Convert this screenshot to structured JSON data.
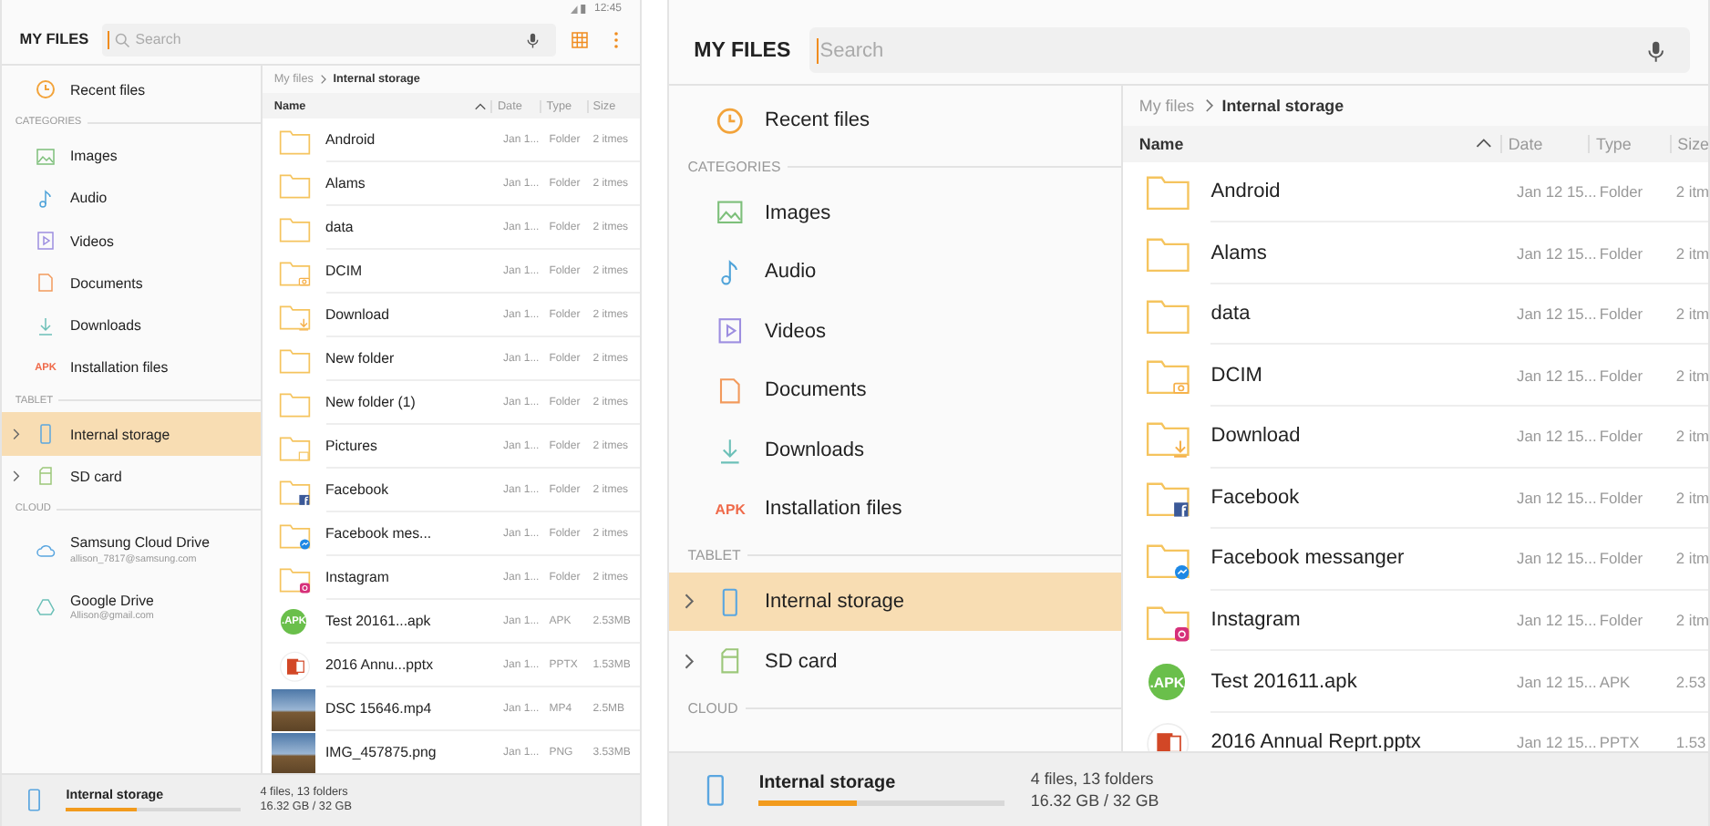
{
  "screens": [
    {
      "status_bar": {
        "time": "12:45"
      },
      "header": {
        "title": "MY FILES",
        "search": {
          "placeholder": "Search"
        }
      },
      "sidebar": [
        {
          "kind": "item",
          "label": "Recent files",
          "selected": false
        },
        {
          "kind": "header",
          "label": "CATEGORIES"
        },
        {
          "kind": "item",
          "label": "Images",
          "selected": false
        },
        {
          "kind": "item",
          "label": "Audio",
          "selected": false
        },
        {
          "kind": "item",
          "label": "Videos",
          "selected": false
        },
        {
          "kind": "item",
          "label": "Documents",
          "selected": false
        },
        {
          "kind": "item",
          "label": "Downloads",
          "selected": false
        },
        {
          "kind": "item",
          "icon_text": "APK",
          "label": "Installation files",
          "selected": false
        },
        {
          "kind": "header",
          "label": "TABLET"
        },
        {
          "kind": "storage",
          "label": "Internal storage",
          "selected": true
        },
        {
          "kind": "storage",
          "label": "SD card",
          "selected": false
        },
        {
          "kind": "header",
          "label": "CLOUD"
        },
        {
          "kind": "account",
          "label": "Samsung Cloud Drive",
          "sublabel": "allison_7817@samsung.com",
          "selected": false
        },
        {
          "kind": "account",
          "label": "Google Drive",
          "sublabel": "Allison@gmail.com",
          "selected": false
        }
      ],
      "breadcrumb": [
        "My files",
        "Internal storage"
      ],
      "columns": [
        "Name",
        "Date",
        "Type",
        "Size"
      ],
      "rows": [
        {
          "kind": "folder",
          "name": "Android",
          "date": "Jan 1...",
          "type": "Folder",
          "size": "2 itmes"
        },
        {
          "kind": "folder",
          "name": "Alams",
          "date": "Jan 1...",
          "type": "Folder",
          "size": "2 itmes"
        },
        {
          "kind": "folder",
          "name": "data",
          "date": "Jan 1...",
          "type": "Folder",
          "size": "2 itmes"
        },
        {
          "kind": "camera",
          "name": "DCIM",
          "date": "Jan 1...",
          "type": "Folder",
          "size": "2 itmes"
        },
        {
          "kind": "download",
          "name": "Download",
          "date": "Jan 1...",
          "type": "Folder",
          "size": "2 itmes"
        },
        {
          "kind": "folder",
          "name": "New folder",
          "date": "Jan 1...",
          "type": "Folder",
          "size": "2 itmes"
        },
        {
          "kind": "folder",
          "name": "New folder (1)",
          "date": "Jan 1...",
          "type": "Folder",
          "size": "2 itmes"
        },
        {
          "kind": "pictures",
          "name": "Pictures",
          "date": "Jan 1...",
          "type": "Folder",
          "size": "2 itmes"
        },
        {
          "kind": "facebook",
          "name": "Facebook",
          "date": "Jan 1...",
          "type": "Folder",
          "size": "2 itmes"
        },
        {
          "kind": "messenger",
          "name": "Facebook mes...",
          "date": "Jan 1...",
          "type": "Folder",
          "size": "2 itmes"
        },
        {
          "kind": "instagram",
          "name": "Instagram",
          "date": "Jan 1...",
          "type": "Folder",
          "size": "2 itmes"
        },
        {
          "kind": "apk",
          "icon_text": ".APK",
          "name": "Test 20161...apk",
          "date": "Jan 1...",
          "type": "APK",
          "size": "2.53MB"
        },
        {
          "kind": "pptx",
          "name": "2016 Annu...pptx",
          "date": "Jan 1...",
          "type": "PPTX",
          "size": "1.53MB"
        },
        {
          "kind": "photo",
          "name": "DSC 15646.mp4",
          "date": "Jan 1...",
          "type": "MP4",
          "size": "2.5MB"
        },
        {
          "kind": "photo",
          "name": "IMG_457875.png",
          "date": "Jan 1...",
          "type": "PNG",
          "size": "3.53MB"
        }
      ],
      "footer": {
        "label": "Internal storage",
        "level": 0.4,
        "counts": "4 files, 13 folders",
        "usage": "16.32 GB / 32 GB"
      }
    },
    {
      "header": {
        "title": "MY FILES",
        "search": {
          "placeholder": "Search"
        }
      },
      "sidebar": [
        {
          "kind": "item",
          "label": "Recent files",
          "selected": false
        },
        {
          "kind": "header",
          "label": "CATEGORIES"
        },
        {
          "kind": "item",
          "label": "Images",
          "selected": false
        },
        {
          "kind": "item",
          "label": "Audio",
          "selected": false
        },
        {
          "kind": "item",
          "label": "Videos",
          "selected": false
        },
        {
          "kind": "item",
          "label": "Documents",
          "selected": false
        },
        {
          "kind": "item",
          "label": "Downloads",
          "selected": false
        },
        {
          "kind": "item",
          "icon_text": "APK",
          "label": "Installation files",
          "selected": false
        },
        {
          "kind": "header",
          "label": "TABLET"
        },
        {
          "kind": "storage",
          "label": "Internal storage",
          "selected": true
        },
        {
          "kind": "storage",
          "label": "SD card",
          "selected": false
        },
        {
          "kind": "header",
          "label": "CLOUD"
        }
      ],
      "breadcrumb": [
        "My files",
        "Internal storage"
      ],
      "columns": [
        "Name",
        "Date",
        "Type",
        "Size"
      ],
      "rows": [
        {
          "kind": "folder",
          "name": "Android",
          "date": "Jan 12 15...",
          "type": "Folder",
          "size": "2 itm"
        },
        {
          "kind": "folder",
          "name": "Alams",
          "date": "Jan 12 15...",
          "type": "Folder",
          "size": "2 itm"
        },
        {
          "kind": "folder",
          "name": "data",
          "date": "Jan 12 15...",
          "type": "Folder",
          "size": "2 itm"
        },
        {
          "kind": "camera",
          "name": "DCIM",
          "date": "Jan 12 15...",
          "type": "Folder",
          "size": "2 itm"
        },
        {
          "kind": "download",
          "name": "Download",
          "date": "Jan 12 15...",
          "type": "Folder",
          "size": "2 itm"
        },
        {
          "kind": "facebook",
          "name": "Facebook",
          "date": "Jan 12 15...",
          "type": "Folder",
          "size": "2 itm"
        },
        {
          "kind": "messenger",
          "name": "Facebook messanger",
          "date": "Jan 12 15...",
          "type": "Folder",
          "size": "2 itm"
        },
        {
          "kind": "instagram",
          "name": "Instagram",
          "date": "Jan 12 15...",
          "type": "Folder",
          "size": "2 itm"
        },
        {
          "kind": "apk",
          "icon_text": ".APK",
          "name": "Test 201611.apk",
          "date": "Jan 12 15...",
          "type": "APK",
          "size": "2.53"
        },
        {
          "kind": "pptx",
          "name": "2016 Annual Reprt.pptx",
          "date": "Jan 12 15...",
          "type": "PPTX",
          "size": "1.53"
        }
      ],
      "footer": {
        "label": "Internal storage",
        "level": 0.4,
        "counts": "4 files, 13 folders",
        "usage": "16.32 GB / 32 GB"
      }
    }
  ]
}
